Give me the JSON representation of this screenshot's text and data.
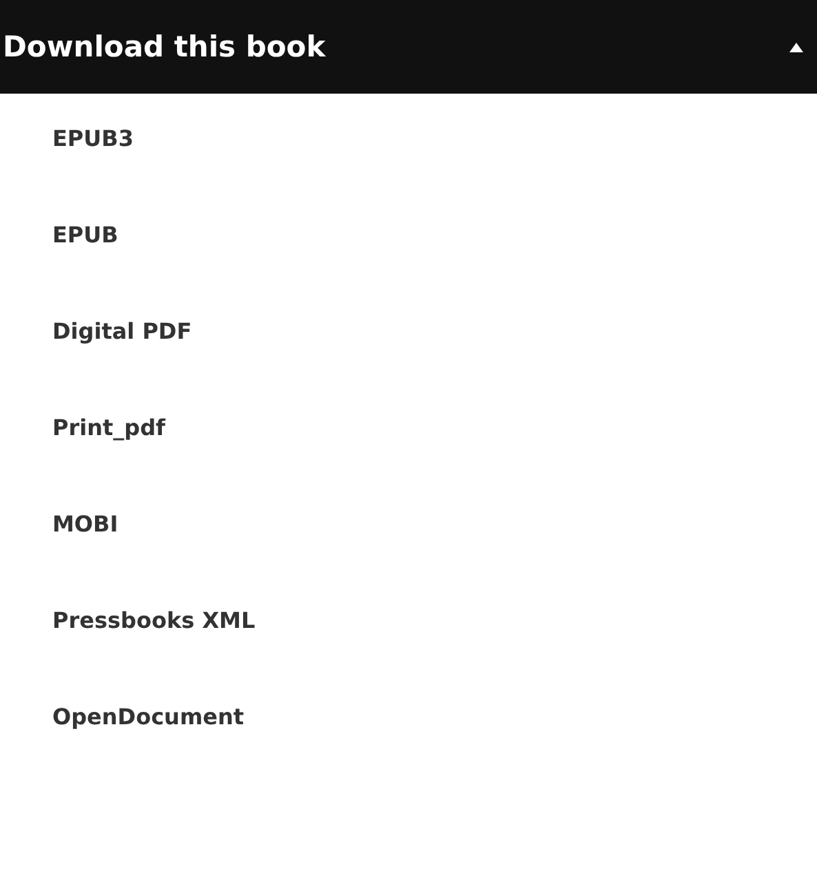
{
  "dropdown": {
    "title": "Download this book",
    "expanded": true,
    "items": [
      "EPUB3",
      "EPUB",
      "Digital PDF",
      "Print_pdf",
      "MOBI",
      "Pressbooks XML",
      "OpenDocument"
    ]
  }
}
